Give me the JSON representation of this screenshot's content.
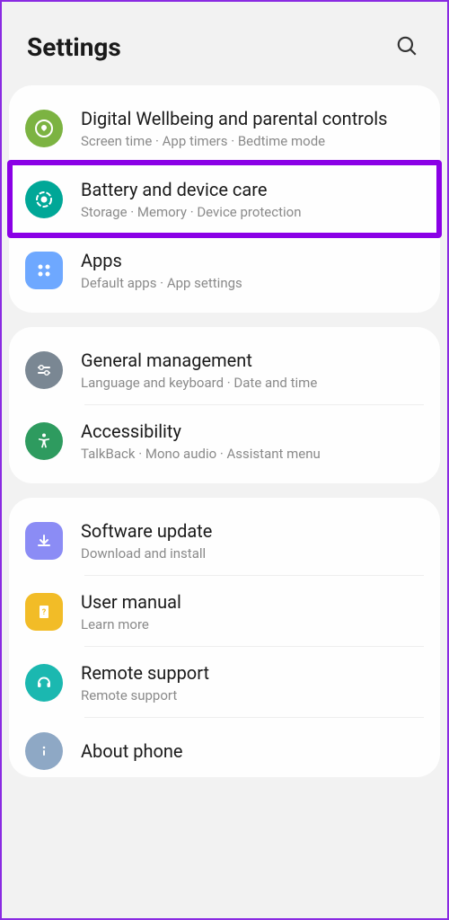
{
  "header": {
    "title": "Settings"
  },
  "sections": {
    "0": {
      "digital_wellbeing": {
        "title": "Digital Wellbeing and parental controls",
        "subtitle": "Screen time  ·  App timers  ·  Bedtime mode"
      },
      "battery_device_care": {
        "title": "Battery and device care",
        "subtitle": "Storage  ·  Memory  ·  Device protection"
      },
      "apps": {
        "title": "Apps",
        "subtitle": "Default apps  ·  App settings"
      }
    },
    "1": {
      "general_management": {
        "title": "General management",
        "subtitle": "Language and keyboard  ·  Date and time"
      },
      "accessibility": {
        "title": "Accessibility",
        "subtitle": "TalkBack  ·  Mono audio  ·  Assistant menu"
      }
    },
    "2": {
      "software_update": {
        "title": "Software update",
        "subtitle": "Download and install"
      },
      "user_manual": {
        "title": "User manual",
        "subtitle": "Learn more"
      },
      "remote_support": {
        "title": "Remote support",
        "subtitle": "Remote support"
      },
      "about_phone": {
        "title": "About phone"
      }
    }
  }
}
